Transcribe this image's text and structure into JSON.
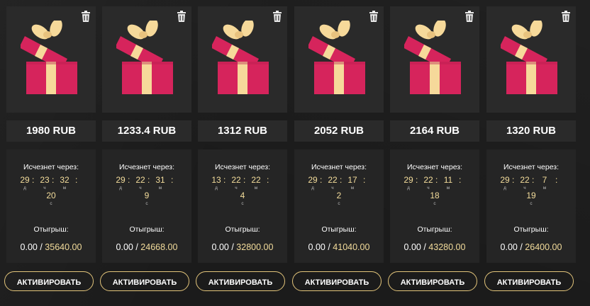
{
  "cards": [
    {
      "price": "1980 RUB",
      "expires_label": "Исчезнет через:",
      "days": "29",
      "hours": "23",
      "minutes": "32",
      "seconds": "20",
      "unit_d": "д",
      "unit_h": "ч",
      "unit_m": "м",
      "unit_s": "с",
      "winnings_label": "Отыгрыш:",
      "win_current": "0.00 / ",
      "win_total": "35640.00",
      "button": "АКТИВИРОВАТЬ"
    },
    {
      "price": "1233.4 RUB",
      "expires_label": "Исчезнет через:",
      "days": "29",
      "hours": "22",
      "minutes": "31",
      "seconds": "9",
      "unit_d": "д",
      "unit_h": "ч",
      "unit_m": "м",
      "unit_s": "с",
      "winnings_label": "Отыгрыш:",
      "win_current": "0.00 / ",
      "win_total": "24668.00",
      "button": "АКТИВИРОВАТЬ"
    },
    {
      "price": "1312 RUB",
      "expires_label": "Исчезнет через:",
      "days": "13",
      "hours": "22",
      "minutes": "22",
      "seconds": "4",
      "unit_d": "д",
      "unit_h": "ч",
      "unit_m": "м",
      "unit_s": "с",
      "winnings_label": "Отыгрыш:",
      "win_current": "0.00 / ",
      "win_total": "32800.00",
      "button": "АКТИВИРОВАТЬ"
    },
    {
      "price": "2052 RUB",
      "expires_label": "Исчезнет через:",
      "days": "29",
      "hours": "22",
      "minutes": "17",
      "seconds": "2",
      "unit_d": "д",
      "unit_h": "ч",
      "unit_m": "м",
      "unit_s": "с",
      "winnings_label": "Отыгрыш:",
      "win_current": "0.00 / ",
      "win_total": "41040.00",
      "button": "АКТИВИРОВАТЬ"
    },
    {
      "price": "2164 RUB",
      "expires_label": "Исчезнет через:",
      "days": "29",
      "hours": "22",
      "minutes": "11",
      "seconds": "18",
      "unit_d": "д",
      "unit_h": "ч",
      "unit_m": "м",
      "unit_s": "с",
      "winnings_label": "Отыгрыш:",
      "win_current": "0.00 / ",
      "win_total": "43280.00",
      "button": "АКТИВИРОВАТЬ"
    },
    {
      "price": "1320 RUB",
      "expires_label": "Исчезнет через:",
      "days": "29",
      "hours": "22",
      "minutes": "7",
      "seconds": "19",
      "unit_d": "д",
      "unit_h": "ч",
      "unit_m": "м",
      "unit_s": "с",
      "winnings_label": "Отыгрыш:",
      "win_current": "0.00 / ",
      "win_total": "26400.00",
      "button": "АКТИВИРОВАТЬ"
    }
  ],
  "colors": {
    "accent_gold": "#e2c47a",
    "timer_gold": "#f3dc9b",
    "gift_red": "#d6245c",
    "gift_ribbon": "#f6d99a",
    "panel_bg": "#2a2a2a"
  },
  "icons": {
    "delete": "trash-icon",
    "gift": "gift-box-icon"
  }
}
